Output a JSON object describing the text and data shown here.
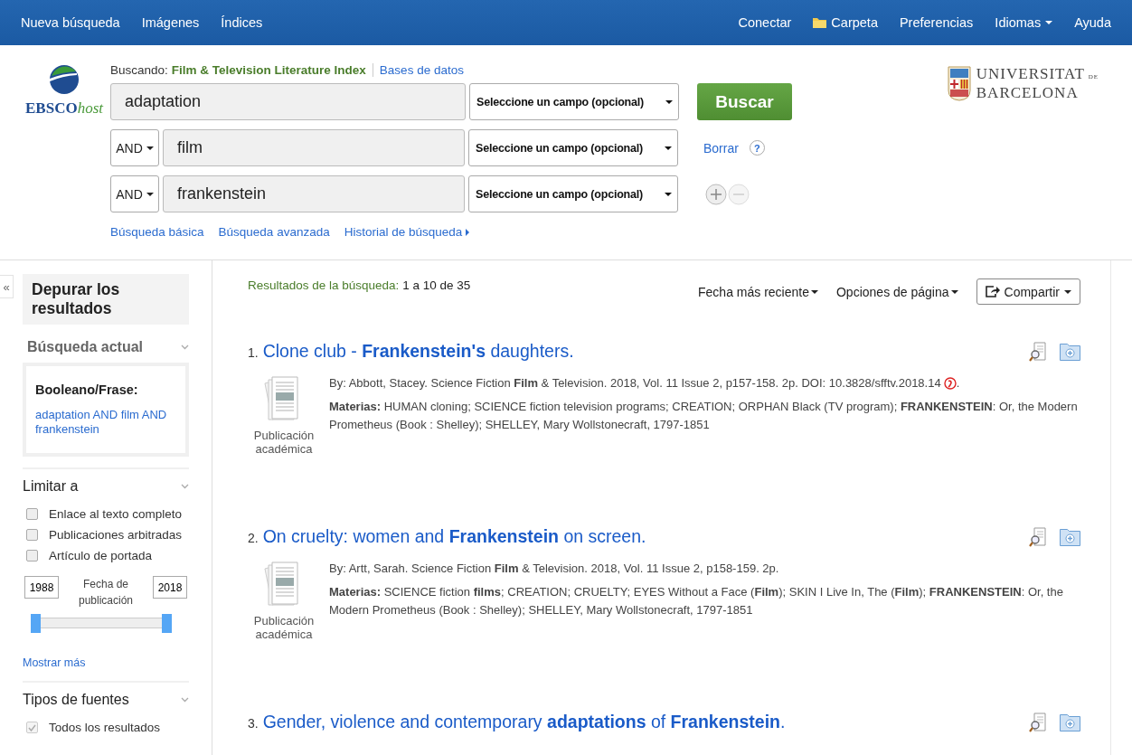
{
  "nav": {
    "left": [
      {
        "label": "Nueva búsqueda",
        "kind": "link"
      },
      {
        "label": "Imágenes",
        "kind": "link"
      },
      {
        "label": "Índices",
        "kind": "link"
      }
    ],
    "right": [
      {
        "label": "Conectar",
        "kind": "link"
      },
      {
        "label": "Carpeta",
        "kind": "folder"
      },
      {
        "label": "Preferencias",
        "kind": "link"
      },
      {
        "label": "Idiomas",
        "kind": "menu"
      },
      {
        "label": "Ayuda",
        "kind": "link"
      }
    ]
  },
  "header": {
    "logo": {
      "main": "EBSCO",
      "suffix": "host"
    },
    "searching_label": "Buscando:",
    "database": "Film & Television Literature Index",
    "databases_link": "Bases de datos",
    "rows": [
      {
        "operator": "",
        "value": "adaptation",
        "field": "Seleccione un campo (opcional)"
      },
      {
        "operator": "AND",
        "value": "film",
        "field": "Seleccione un campo (opcional)"
      },
      {
        "operator": "AND",
        "value": "frankenstein",
        "field": "Seleccione un campo (opcional)"
      }
    ],
    "search_button": "Buscar",
    "clear_link": "Borrar",
    "help": "?",
    "links": [
      {
        "label": "Búsqueda básica",
        "kind": "link"
      },
      {
        "label": "Búsqueda avanzada",
        "kind": "link"
      },
      {
        "label": "Historial de búsqueda",
        "kind": "menu"
      }
    ],
    "university": {
      "line1": "UNIVERSITAT",
      "de": "DE",
      "line2": "BARCELONA"
    }
  },
  "sidebar": {
    "collapse": "«",
    "title": "Depurar los resultados",
    "current_search": {
      "heading": "Búsqueda actual",
      "label": "Booleano/Frase:",
      "query": "adaptation AND film AND frankenstein"
    },
    "limit": {
      "heading": "Limitar a",
      "options": [
        {
          "label": "Enlace al texto completo",
          "checked": false
        },
        {
          "label": "Publicaciones arbitradas",
          "checked": false
        },
        {
          "label": "Artículo de portada",
          "checked": false
        }
      ],
      "from": "1988",
      "to": "2018",
      "date_label": "Fecha de publicación",
      "thumbs": [
        {
          "level": 0
        },
        {
          "level": 1
        }
      ],
      "more": "Mostrar más"
    },
    "source_types": {
      "heading": "Tipos de fuentes",
      "options": [
        {
          "label": "Todos los resultados",
          "checked": true,
          "disabled": true
        }
      ]
    }
  },
  "results": {
    "label": "Resultados de la búsqueda:",
    "range": "1 a 10 de 35",
    "sort": "Fecha más reciente",
    "page_options": "Opciones de página",
    "share": "Compartir",
    "items": [
      {
        "number": "1.",
        "title": "Clone club - **Frankenstein's** daughters.",
        "type": "Publicación académica",
        "byline": "By: Abbott, Stacey. Science Fiction **Film** & Television. 2018, Vol. 11 Issue 2, p157-158. 2p. DOI: 10.3828/sfftv.2018.14",
        "doi_mark": true,
        "byline_end": ".",
        "subjects": "**Materias:** HUMAN cloning; SCIENCE fiction television programs; CREATION; ORPHAN Black (TV program); **FRANKENSTEIN**: Or, the Modern Prometheus (Book : Shelley); SHELLEY, Mary Wollstonecraft, 1797-1851"
      },
      {
        "number": "2.",
        "title": "On cruelty: women and **Frankenstein** on screen.",
        "type": "Publicación académica",
        "byline": "By: Artt, Sarah. Science Fiction **Film** & Television. 2018, Vol. 11 Issue 2, p158-159. 2p.",
        "subjects": "**Materias:** SCIENCE fiction **films**; CREATION; CRUELTY; EYES Without a Face (**Film**); SKIN I Live In, The (**Film**); **FRANKENSTEIN**: Or, the Modern Prometheus (Book : Shelley); SHELLEY, Mary Wollstonecraft, 1797-1851"
      },
      {
        "number": "3.",
        "title": "Gender, violence and contemporary **adaptations** of **Frankenstein**."
      }
    ]
  }
}
